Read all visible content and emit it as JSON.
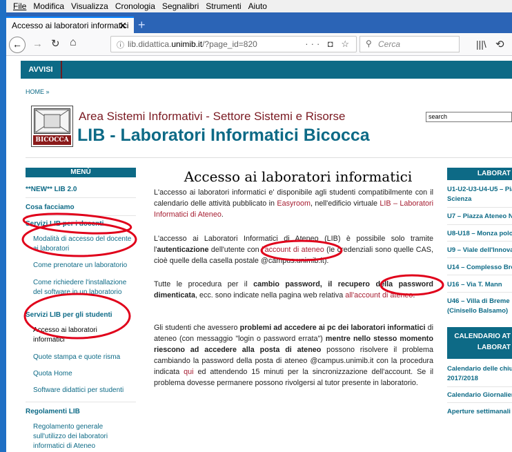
{
  "browser": {
    "menu": [
      "File",
      "Modifica",
      "Visualizza",
      "Cronologia",
      "Segnalibri",
      "Strumenti",
      "Aiuto"
    ],
    "tab_title": "Accesso ai laboratori informatici",
    "tab_close": "✕",
    "new_tab": "+",
    "url_host": "lib.didattica.unimib.it",
    "url_prefix": "lib.didattica.",
    "url_domain": "unimib.it",
    "url_path": "/?page_id=820",
    "url_actions": "··· ◘ ☆",
    "search_placeholder": "Cerca"
  },
  "site": {
    "top_nav": "AVVISI",
    "breadcrumb": "HOME »",
    "logo_text": "BICOCCA",
    "subtitle": "Area Sistemi Informativi - Settore Sistemi e Risorse",
    "title": "LIB - Laboratori Informatici Bicocca",
    "search_value": "search"
  },
  "sidebar_left": {
    "header": "MENÙ",
    "items": [
      "**NEW** LIB 2.0",
      "Cosa facciamo",
      "Servizi LIB per i docenti",
      "Modalità di accesso del docente",
      "ai laboratori",
      "Come prenotare un laboratorio",
      "Come richiedere l'installazione",
      "del software in un laboratorio",
      "Servizi LIB per gli studenti",
      "Accesso ai laboratori",
      "informatici",
      "Quote stampa e quote risma",
      "Quota Home",
      "Software didattici per studenti",
      "Regolamenti LIB",
      "Regolamento generale",
      "sull'utilizzo dei laboratori",
      "informatici di Ateneo"
    ]
  },
  "main": {
    "title": "Accesso ai laboratori informatici",
    "p1": {
      "a": "L'accesso ai laboratori informatici e' disponibile agli studenti compatibilmente con il calendario delle attività pubblicato in ",
      "link1": "Easyroom",
      "b": ", nell'edificio virtuale ",
      "link2": "LIB – Laboratori Informatici di Ateneo",
      "c": "."
    },
    "p2": {
      "a": "L'accesso ai Laboratori Informatici di Ateneo (LIB) è possibile solo tramite l'",
      "bold": "autenticazione",
      "b": " dell'utente con ",
      "link": "l'account di ateneo",
      "c": " (le credenziali sono quelle CAS, cioè quelle della casella postale @campus.unimib.it)."
    },
    "p3": {
      "a": "Tutte le procedura per il ",
      "bold1": "cambio password, il recupero della password dimenticata",
      "b": ", ecc. sono indicate nella pagina web relativa ",
      "link": "all'account di ateneo",
      "c": "."
    },
    "p4": {
      "a": "Gli studenti che avessero ",
      "bold1": "problemi ad accedere ai pc dei laboratori informatici",
      "b": " di ateneo (con messaggio \"login o password errata\") ",
      "bold2": "mentre nello stesso momento riescono ad accedere alla posta di ateneo",
      "c": " possono risolvere il problema cambiando la password della posta di ateneo @campus.unimib.it con la procedura indicata ",
      "link": "qui",
      "d": " ed attendendo 15 minuti per la sincronizzazione dell'account. Se il problema dovesse permanere possono rivolgersi al tutor presente in laboratorio."
    }
  },
  "sidebar_right": {
    "header1": "LABORAT",
    "items": [
      "U1-U2-U3-U4-U5 – Pia",
      "Scienza",
      "U7 – Piazza Ateneo N",
      "U8-U18 – Monza polo",
      "U9 – Viale dell'Innova",
      "U14 – Complesso Bro",
      "U16 – Via T. Mann",
      "U46 – Villa di Breme",
      "(Cinisello Balsamo)"
    ],
    "header2_line1": "CALENDARIO AT",
    "header2_line2": "LABORAT",
    "items2": [
      "Calendario delle chiu",
      "2017/2018",
      "Calendario Giornalier",
      "Aperture settimanali"
    ]
  }
}
